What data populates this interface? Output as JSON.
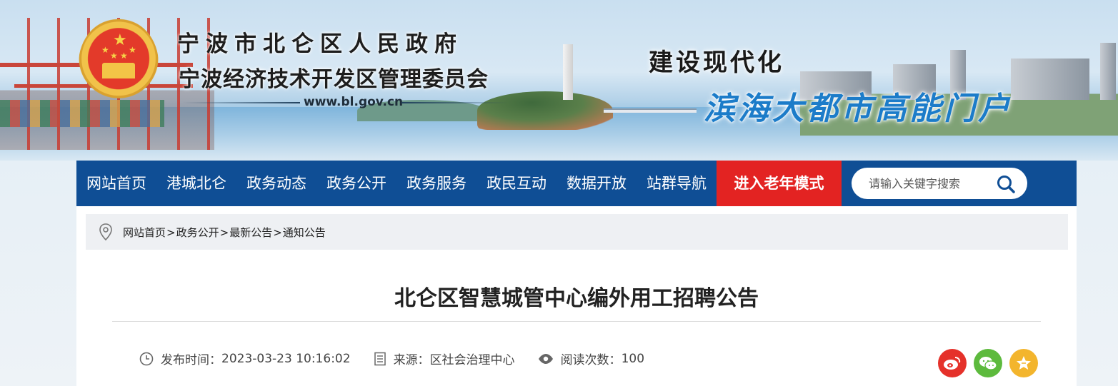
{
  "header": {
    "gov_name": "宁波市北仑区人民政府",
    "gov_name2": "宁波经济技术开发区管理委员会",
    "url": "www.bl.gov.cn",
    "slogan1": "建设现代化",
    "slogan2": "滨海大都市高能门户"
  },
  "nav": {
    "items": [
      "网站首页",
      "港城北仑",
      "政务动态",
      "政务公开",
      "政务服务",
      "政民互动",
      "数据开放",
      "站群导航"
    ],
    "elder_mode": "进入老年模式",
    "search_placeholder": "请输入关键字搜索"
  },
  "breadcrumb": {
    "items": [
      "网站首页",
      "政务公开",
      "最新公告",
      "通知公告"
    ],
    "separator": ">"
  },
  "article": {
    "title": "北仑区智慧城管中心编外用工招聘公告",
    "publish_label": "发布时间：",
    "publish_time": "2023-03-23 10:16:02",
    "source_label": "来源：",
    "source": "区社会治理中心",
    "views_label": "阅读次数：",
    "views": "100"
  },
  "share": {
    "buttons": [
      "weibo-icon",
      "wechat-icon",
      "favorite-icon"
    ],
    "colors": {
      "weibo": "#e5312a",
      "wechat": "#5dba3d",
      "favorite": "#f3b52d"
    }
  },
  "colors": {
    "nav_bg": "#0f4e95",
    "elder_bg": "#e32322",
    "slogan_blue": "#1c7cc9"
  }
}
